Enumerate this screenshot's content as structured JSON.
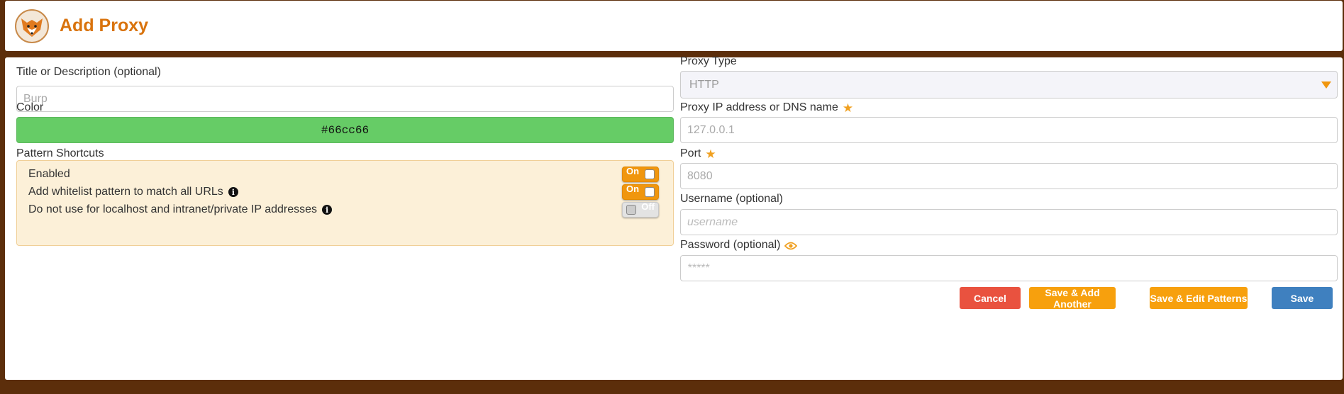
{
  "header": {
    "title": "Add Proxy",
    "logo_icon": "fox-logo-icon"
  },
  "form": {
    "title": {
      "label": "Title or Description (optional)",
      "placeholder": "Burp"
    },
    "color": {
      "label": "Color",
      "value": "#66cc66"
    },
    "pattern_shortcuts": {
      "label": "Pattern Shortcuts",
      "items": [
        {
          "label": "Enabled",
          "state": "On",
          "info": false
        },
        {
          "label": "Add whitelist pattern to match all URLs",
          "state": "On",
          "info": true
        },
        {
          "label": "Do not use for localhost and intranet/private IP addresses",
          "state": "Off",
          "info": true
        }
      ]
    },
    "proxy_type": {
      "label": "Proxy Type",
      "value": "HTTP"
    },
    "proxy_ip": {
      "label": "Proxy IP address or DNS name",
      "placeholder": "127.0.0.1",
      "required": true
    },
    "port": {
      "label": "Port",
      "placeholder": "8080",
      "required": true
    },
    "username": {
      "label": "Username (optional)",
      "placeholder": "username"
    },
    "password": {
      "label": "Password (optional)",
      "placeholder": "*****"
    }
  },
  "buttons": {
    "cancel": "Cancel",
    "save_add_another": "Save & Add Another",
    "save_edit_patterns": "Save & Edit Patterns",
    "save": "Save"
  },
  "colors": {
    "accent": "#d9730d",
    "toggle_on": "#f0960e",
    "cancel": "#e9523f",
    "save_secondary": "#f7a00d",
    "save_primary": "#3f80bf",
    "frame": "#5c2e0b"
  }
}
